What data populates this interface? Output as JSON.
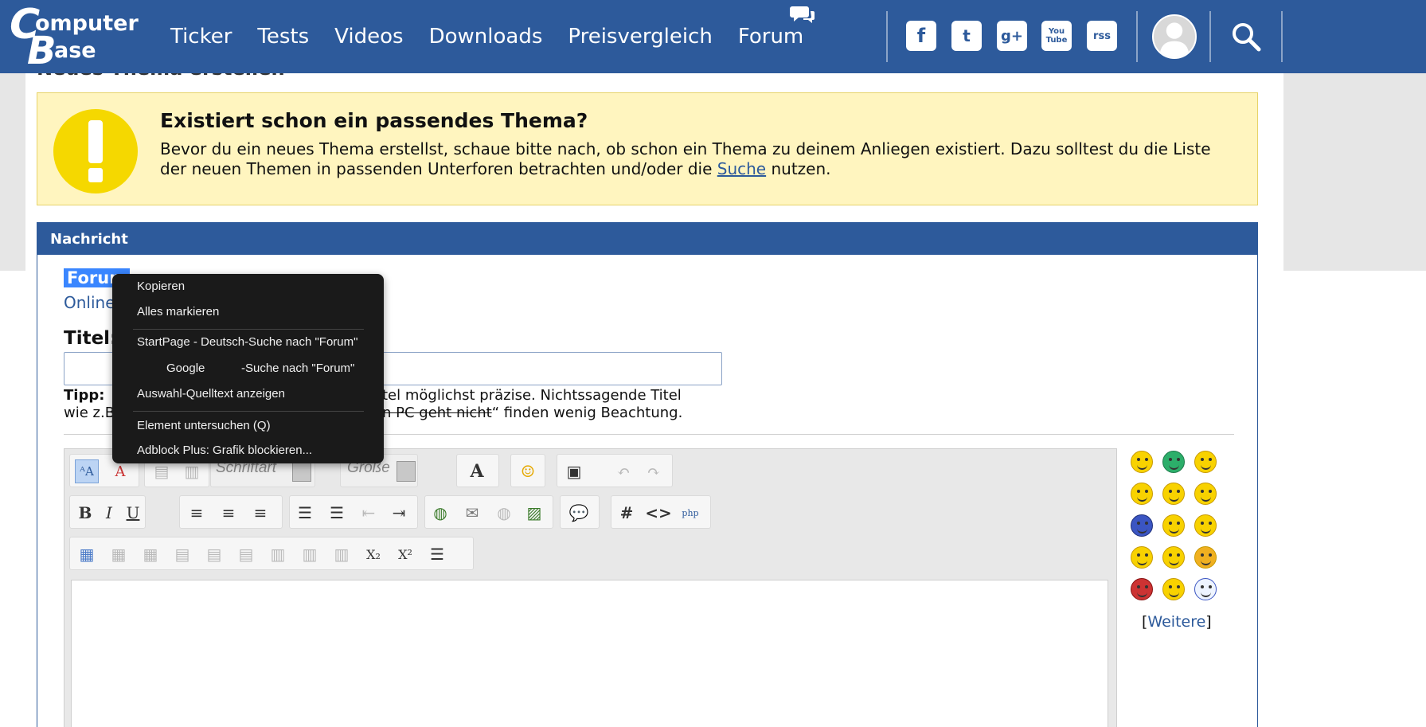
{
  "header": {
    "logo_text": "Computer Base",
    "nav": [
      {
        "label": "Ticker"
      },
      {
        "label": "Tests"
      },
      {
        "label": "Videos"
      },
      {
        "label": "Downloads"
      },
      {
        "label": "Preisvergleich"
      },
      {
        "label": "Forum"
      }
    ],
    "social_icons": [
      "facebook-icon",
      "twitter-icon",
      "google-plus-icon",
      "youtube-icon",
      "rss-icon"
    ],
    "social_labels": [
      "f",
      "t",
      "g+",
      "You Tube",
      "rss"
    ],
    "brand_color": "#2d5a9b"
  },
  "page": {
    "title": "Neues Thema erstellen"
  },
  "notice": {
    "heading": "Existiert schon ein passendes Thema?",
    "text_before_link": "Bevor du ein neues Thema erstellst, schaue bitte nach, ob schon ein Thema zu deinem Anliegen existiert. Dazu solltest du die Liste der neuen Themen in passenden Unterforen betrachten und/oder die ",
    "link": "Suche",
    "text_after_link": " nutzen."
  },
  "panel": {
    "heading": "Nachricht",
    "selected_text": "Forum",
    "online_text": "Online",
    "title_label": "Titel:",
    "title_value": "",
    "tipp_label": "Tipp:",
    "tipp_line1_visible": "tel möglichst präzise. Nichtssagende Titel",
    "tipp_line2_start": "wie z.B",
    "tipp_line2_strike": "n PC geht nicht",
    "tipp_line2_end": "“ finden wenig Beachtung."
  },
  "editor": {
    "font_placeholder": "Schriftart",
    "size_placeholder": "Größe",
    "bold": "B",
    "italic": "I",
    "underline": "U",
    "hash": "#",
    "code": "<>",
    "font_color": "A",
    "sub": "X₂",
    "sup": "X²",
    "more_smileys": "Weitere"
  },
  "context_menu": {
    "items": [
      {
        "label": "Kopieren",
        "accesskey": "K"
      },
      {
        "label": "Alles markieren",
        "accesskey": "m"
      },
      {
        "label": "StartPage - Deutsch-Suche nach \"Forum\"",
        "accesskey": "S"
      },
      {
        "label_prefix": "Google",
        "label_suffix": "-Suche nach \"Forum\""
      },
      {
        "label": "Auswahl-Quelltext anzeigen",
        "accesskey": "A"
      },
      {
        "label": "Element untersuchen (Q)",
        "accesskey": "Q"
      },
      {
        "label": "Adblock Plus: Grafik blockieren..."
      }
    ]
  }
}
